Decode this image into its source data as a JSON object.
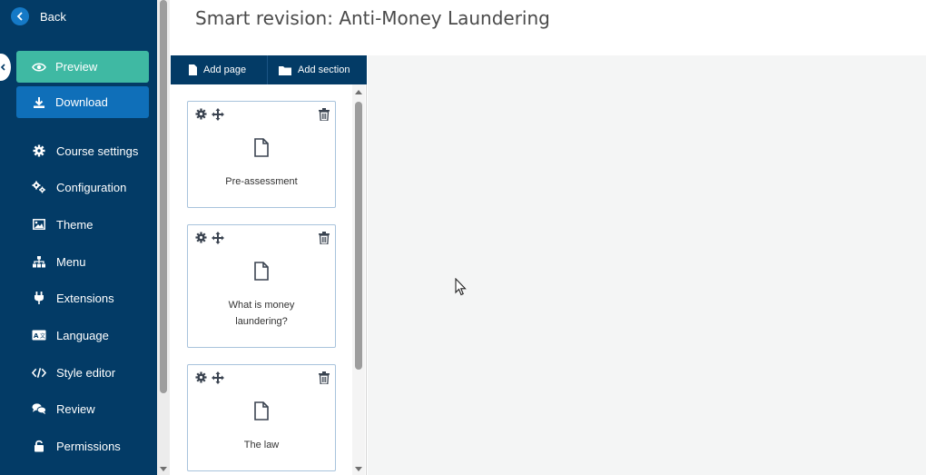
{
  "app": {
    "title": "Smart revision: Anti-Money Laundering"
  },
  "sidebar": {
    "back_label": "Back",
    "preview_label": "Preview",
    "download_label": "Download",
    "items": [
      {
        "label": "Course settings",
        "icon": "gear-icon"
      },
      {
        "label": "Configuration",
        "icon": "gears-icon"
      },
      {
        "label": "Theme",
        "icon": "image-icon"
      },
      {
        "label": "Menu",
        "icon": "sitemap-icon"
      },
      {
        "label": "Extensions",
        "icon": "plug-icon"
      },
      {
        "label": "Language",
        "icon": "language-icon"
      },
      {
        "label": "Style editor",
        "icon": "code-icon"
      },
      {
        "label": "Review",
        "icon": "comments-icon"
      },
      {
        "label": "Permissions",
        "icon": "lock-icon"
      }
    ]
  },
  "pages_panel": {
    "add_page_label": "Add page",
    "add_section_label": "Add section",
    "pages": [
      {
        "line1": "Pre-assessment",
        "line2": ""
      },
      {
        "line1": "What is money",
        "line2": "laundering?"
      },
      {
        "line1": "The law",
        "line2": ""
      }
    ]
  },
  "colors": {
    "sidebar_bg": "#033b66",
    "preview_bg": "#3fb9a3",
    "download_bg": "#0f6fb9",
    "card_border": "#a8c3dc",
    "canvas_bg": "#f4f5f5"
  }
}
